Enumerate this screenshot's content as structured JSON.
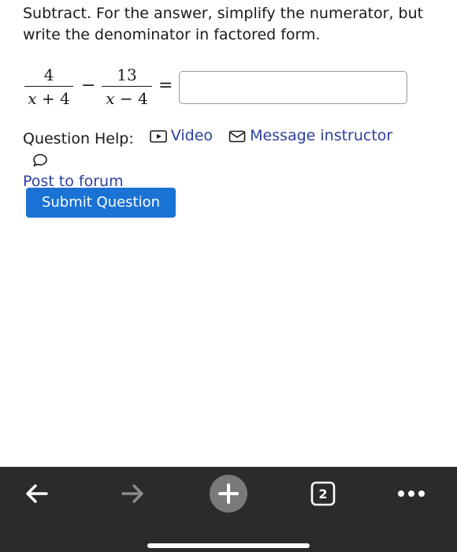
{
  "question": {
    "instructions": "Subtract. For the answer, simplify the numerator, but write the denominator in factored form.",
    "fraction1": {
      "numerator": "4",
      "denominator_var": "x",
      "denominator_rest": " + 4"
    },
    "minus_sign": "−",
    "fraction2": {
      "numerator": "13",
      "denominator_var": "x",
      "denominator_rest": " − 4"
    },
    "equals_sign": "=",
    "answer_value": ""
  },
  "help": {
    "label": "Question Help:",
    "video_label": "Video",
    "message_label": "Message instructor",
    "forum_label": "Post to forum"
  },
  "submit_label": "Submit Question",
  "browser_toolbar": {
    "tab_count": "2",
    "back_icon": "arrow-left-icon",
    "forward_icon": "arrow-right-icon",
    "new_tab_icon": "plus-icon",
    "menu_icon": "more-dots-icon"
  },
  "colors": {
    "link": "#2c3f9e",
    "submit_bg": "#1a73d4",
    "toolbar_bg": "#2b2b2b"
  }
}
